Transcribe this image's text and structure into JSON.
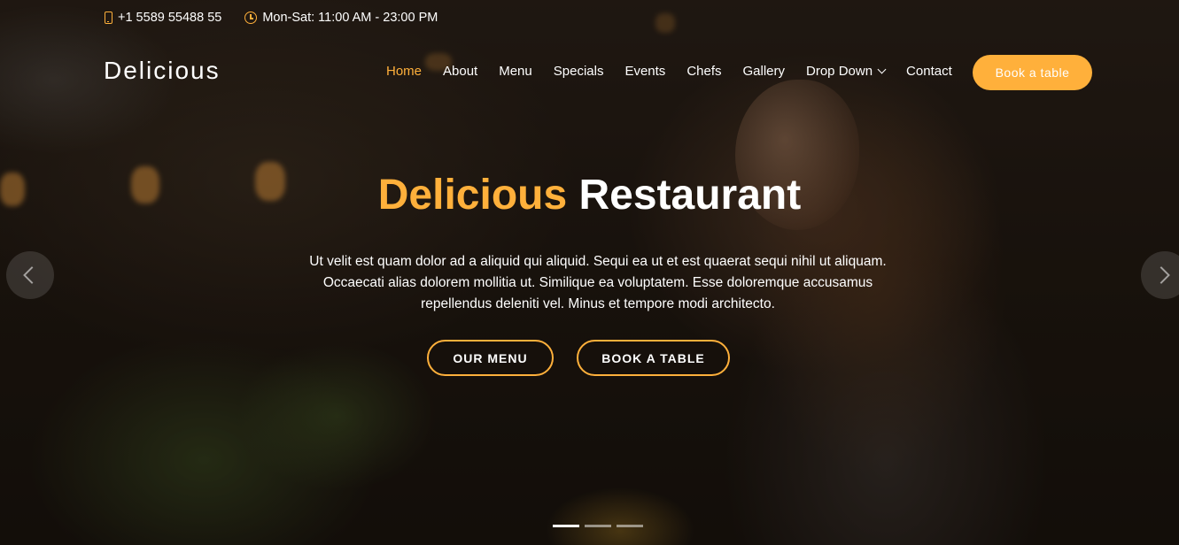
{
  "topbar": {
    "phone": "+1 5589 55488 55",
    "hours": "Mon-Sat: 11:00 AM - 23:00 PM"
  },
  "header": {
    "logo": "Delicious",
    "nav": {
      "home": "Home",
      "about": "About",
      "menu": "Menu",
      "specials": "Specials",
      "events": "Events",
      "chefs": "Chefs",
      "gallery": "Gallery",
      "dropdown": "Drop Down",
      "contact": "Contact"
    },
    "book_button": "Book a table"
  },
  "hero": {
    "title_accent": "Delicious",
    "title_rest": "Restaurant",
    "text": "Ut velit est quam dolor ad a aliquid qui aliquid. Sequi ea ut et est quaerat sequi nihil ut aliquam. Occaecati alias dolorem mollitia ut. Similique ea voluptatem. Esse doloremque accusamus repellendus deleniti vel. Minus et tempore modi architecto.",
    "btn_menu": "OUR MENU",
    "btn_book": "BOOK A TABLE"
  },
  "carousel": {
    "slides": 3,
    "active": 1
  },
  "colors": {
    "accent": "#ffb03b"
  }
}
